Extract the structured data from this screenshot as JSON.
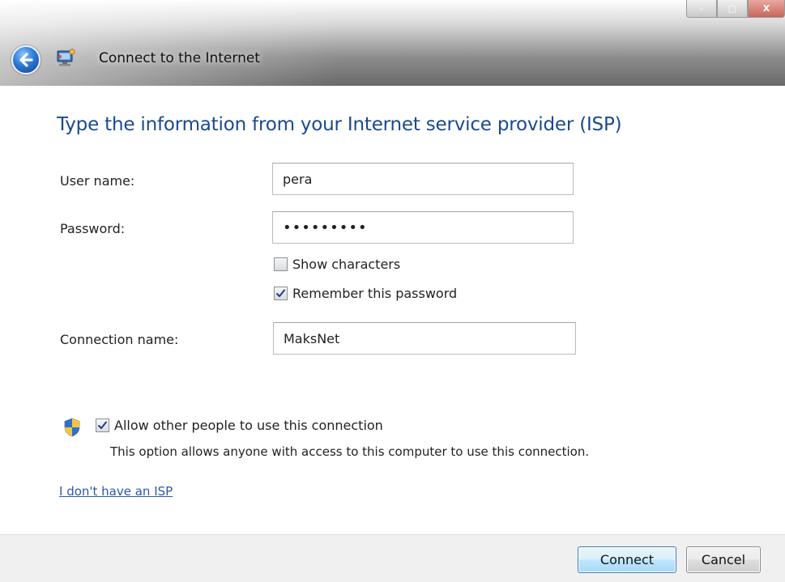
{
  "window": {
    "title": "Connect to the Internet",
    "controls": {
      "minimize": "–",
      "maximize": "□",
      "close": "X"
    }
  },
  "form": {
    "heading": "Type the information from your Internet service provider (ISP)",
    "username": {
      "label": "User name:",
      "value": "pera"
    },
    "password": {
      "label": "Password:",
      "value": "•••••••••"
    },
    "show_characters": {
      "label": "Show characters",
      "checked": false
    },
    "remember_password": {
      "label": "Remember this password",
      "checked": true
    },
    "connection_name": {
      "label": "Connection name:",
      "value": "MaksNet"
    },
    "allow_others": {
      "label": "Allow other people to use this connection",
      "checked": true,
      "description": "This option allows anyone with access to this computer to use this connection."
    },
    "no_isp_link": "I don't have an ISP"
  },
  "buttons": {
    "connect": "Connect",
    "cancel": "Cancel"
  },
  "colors": {
    "heading": "#1a4a8c",
    "link": "#2b58a8",
    "back_button": "#2d7ad6"
  },
  "icons": {
    "back": "back-arrow-icon",
    "app": "network-connection-icon",
    "shield": "uac-shield-icon",
    "check": "checkmark-icon"
  }
}
